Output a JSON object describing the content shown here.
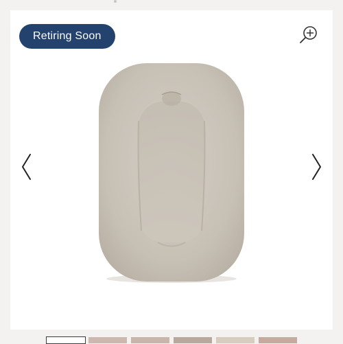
{
  "badge": {
    "label": "Retiring Soon",
    "color": "#23426e"
  },
  "zoom": {
    "icon": "zoom-in-icon"
  },
  "carousel": {
    "prev_icon": "chevron-left-icon",
    "next_icon": "chevron-right-icon",
    "image": {
      "description_icon": "baby-lounger-image"
    }
  },
  "thumbnails": [
    {
      "active": true,
      "tone": "#ffffff"
    },
    {
      "active": false,
      "tone": "#cdb8b0"
    },
    {
      "active": false,
      "tone": "#c9b5a9"
    },
    {
      "active": false,
      "tone": "#b9a99d"
    },
    {
      "active": false,
      "tone": "#d7cdbf"
    },
    {
      "active": false,
      "tone": "#c8a9a0"
    }
  ]
}
